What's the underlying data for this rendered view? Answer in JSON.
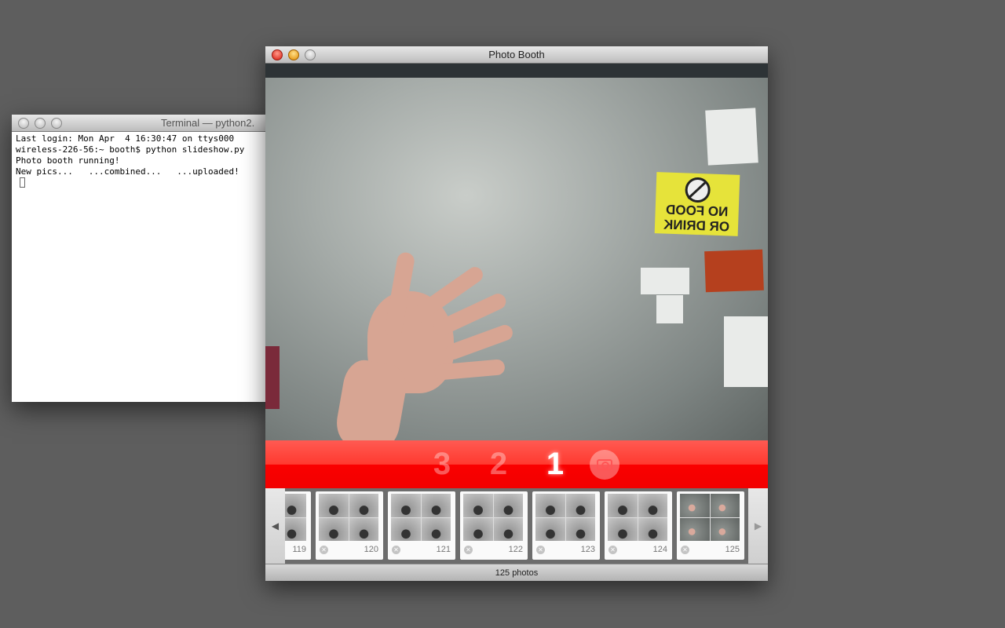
{
  "terminal": {
    "title": "Terminal — python2.",
    "lines": [
      "Last login: Mon Apr  4 16:30:47 on ttys000",
      "wireless-226-56:~ booth$ python slideshow.py",
      "Photo booth running!",
      "New pics...   ...combined...   ...uploaded!"
    ]
  },
  "photobooth": {
    "title": "Photo Booth",
    "sign_text": [
      "NO FOOD",
      "OR DRINK"
    ],
    "countdown": [
      "3",
      "2",
      "1"
    ],
    "active_count": "1",
    "thumbnails": [
      {
        "number": "119"
      },
      {
        "number": "120"
      },
      {
        "number": "121"
      },
      {
        "number": "122"
      },
      {
        "number": "123"
      },
      {
        "number": "124"
      },
      {
        "number": "125"
      }
    ],
    "status": "125 photos",
    "accent_color": "#ff0000"
  }
}
